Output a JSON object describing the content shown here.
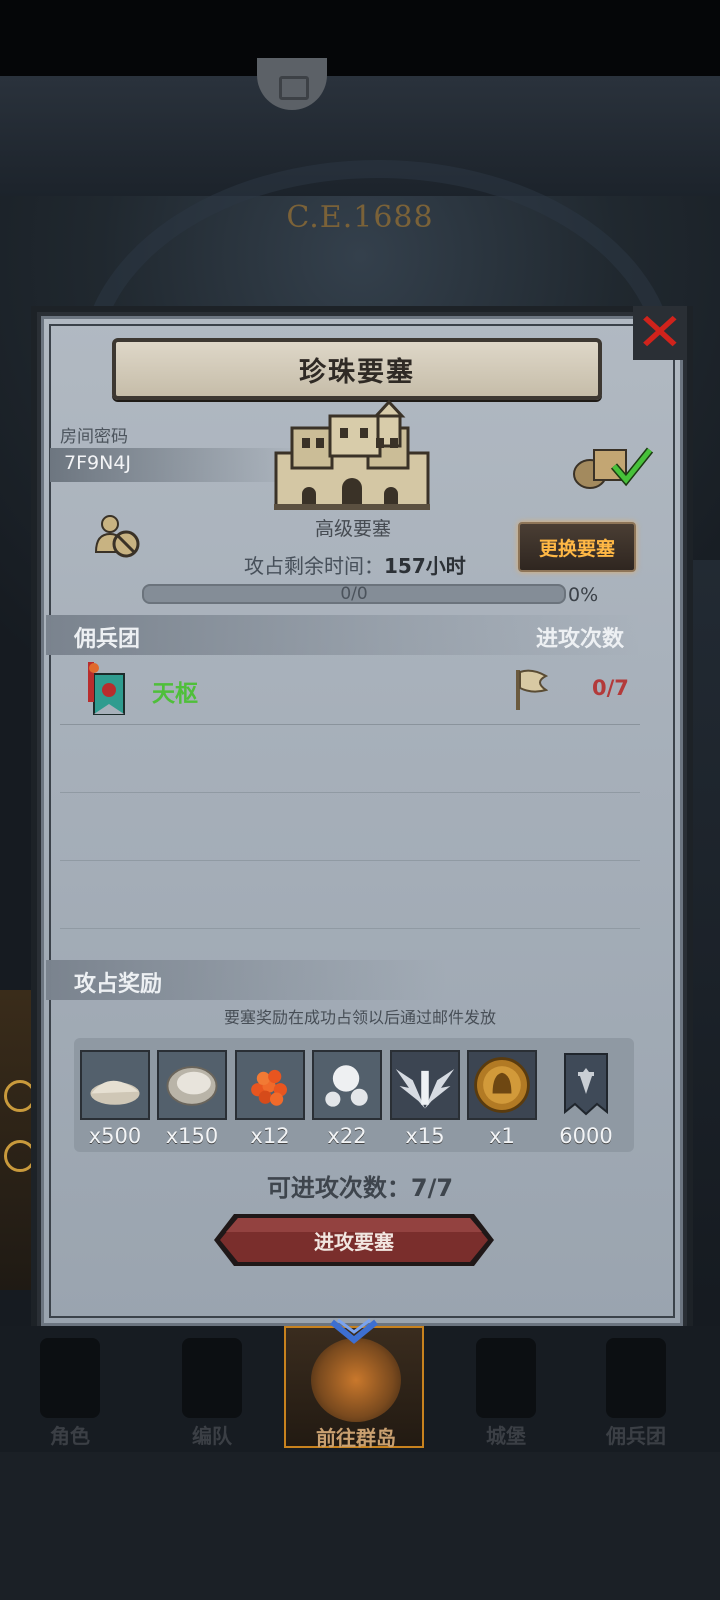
{
  "background": {
    "era_text": "C.E.1688"
  },
  "modal": {
    "title": "珍珠要塞",
    "close_icon": "close-x-icon",
    "room": {
      "label": "房间密码",
      "code": "7F9N4J"
    },
    "fortress": {
      "level_label": "高级要塞",
      "change_button": "更换要塞",
      "remaining_label": "攻占剩余时间：",
      "remaining_value": "157小时",
      "progress_text": "0/0",
      "progress_percent": "0%",
      "progress_fraction": 0
    },
    "mercenary_section": {
      "title": "佣兵团",
      "attack_count_title": "进攻次数",
      "rows": [
        {
          "name": "天枢",
          "count": "0/7",
          "name_color": "#4fbf3a",
          "count_color": "#b33a3a"
        }
      ]
    },
    "reward_section": {
      "title": "攻占奖励",
      "note": "要塞奖励在成功占领以后通过邮件发放",
      "items": [
        {
          "icon": "salt-pile-icon",
          "qty": "x500"
        },
        {
          "icon": "oyster-icon",
          "qty": "x150"
        },
        {
          "icon": "roe-icon",
          "qty": "x12"
        },
        {
          "icon": "pearl-icon",
          "qty": "x22"
        },
        {
          "icon": "silver-wings-icon",
          "qty": "x15"
        },
        {
          "icon": "knight-medal-icon",
          "qty": "x1"
        },
        {
          "icon": "banner-icon",
          "qty": "6000"
        }
      ]
    },
    "attack_left_label": "可进攻次数：",
    "attack_left_value": "7/7",
    "attack_button": "进攻要塞"
  },
  "bottom_nav": {
    "items": [
      {
        "label": "角色",
        "icon": "character-icon",
        "active": false
      },
      {
        "label": "编队",
        "icon": "formation-icon",
        "active": false
      },
      {
        "label": "前往群岛",
        "icon": "islands-icon",
        "active": true
      },
      {
        "label": "城堡",
        "icon": "castle-icon",
        "active": false
      },
      {
        "label": "佣兵团",
        "icon": "mercenary-icon",
        "active": false
      }
    ]
  },
  "colors": {
    "accent_gold": "#ffb845",
    "attack_button": "#7a2e2c",
    "nav_active_border": "#c8821e"
  }
}
